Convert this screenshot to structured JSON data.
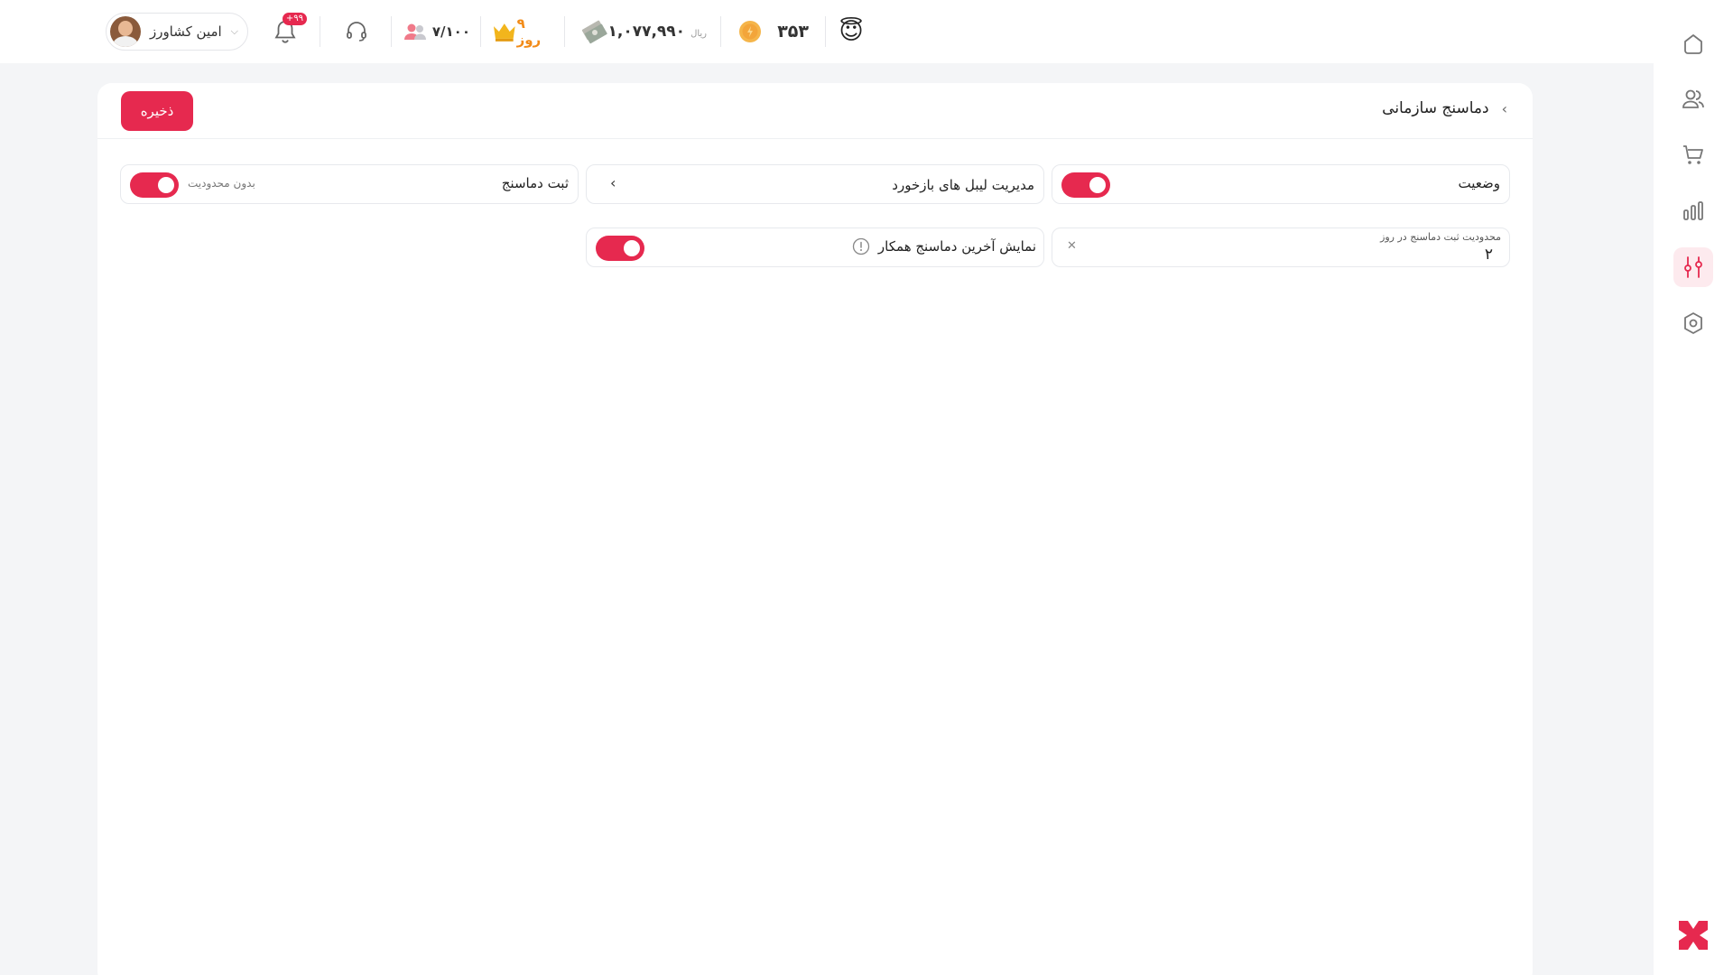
{
  "header": {
    "user_name": "امین کشاورز",
    "notifications_badge": "+۹۹",
    "users_count": "۷/۱۰۰",
    "subscription_days": "۹ روز",
    "balance": "۱,۰۷۷,۹۹۰",
    "balance_unit": "ریال",
    "coins": "۳۵۳",
    "mood_emoji": "😇",
    "icons": [
      "avatar",
      "chevron-down-icon",
      "bell-icon",
      "headset-icon",
      "users-icon",
      "crown-icon",
      "money-icon",
      "coin-icon"
    ]
  },
  "sidebar": {
    "items": [
      {
        "name": "home",
        "icon": "home-icon",
        "active": false
      },
      {
        "name": "users",
        "icon": "users-icon",
        "active": false
      },
      {
        "name": "cart",
        "icon": "cart-icon",
        "active": false
      },
      {
        "name": "reports",
        "icon": "chart-icon",
        "active": false
      },
      {
        "name": "settings-sliders",
        "icon": "sliders-icon",
        "active": true
      },
      {
        "name": "settings",
        "icon": "hexagon-settings-icon",
        "active": false
      }
    ],
    "logo": "brand-logo"
  },
  "page": {
    "title": "دماسنج سازمانی",
    "save_label": "ذخیره",
    "status": {
      "label": "وضعیت",
      "enabled": true
    },
    "feedback_labels": {
      "label": "مدیریت لیبل های بازخورد"
    },
    "register": {
      "label": "ثبت دماسنج",
      "note": "بدون محدودیت",
      "enabled": true
    },
    "daily_limit": {
      "label": "محدودیت ثبت دماسنج در روز",
      "value": "۲"
    },
    "show_last": {
      "label": "نمایش آخرین دماسنج همکار",
      "enabled": true
    }
  },
  "colors": {
    "accent": "#e6294f",
    "accent_soft": "#fdeaee",
    "orange": "#f28b18"
  }
}
